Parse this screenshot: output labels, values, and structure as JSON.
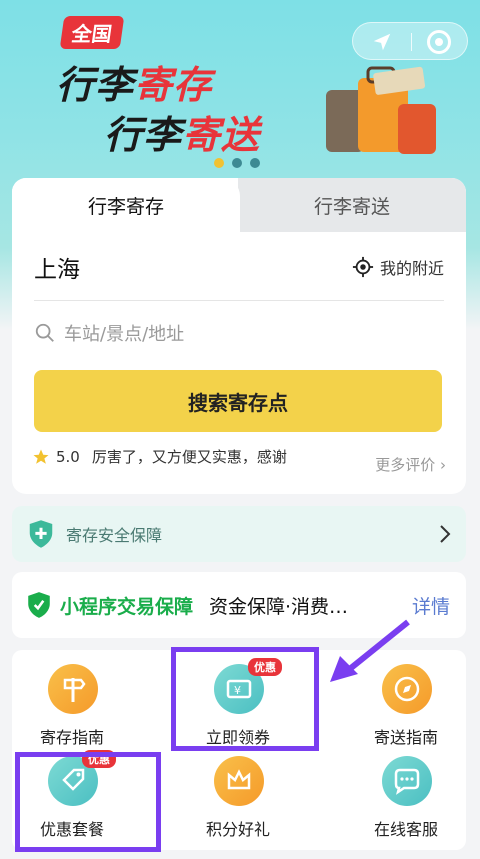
{
  "banner": {
    "chip": "全国",
    "line1_a": "行李",
    "line1_b": "寄存",
    "line2_a": "行李",
    "line2_b": "寄送"
  },
  "tabs": {
    "active": "行李寄存",
    "inactive": "行李寄送"
  },
  "location": {
    "city": "上海",
    "nearby_label": "我的附近"
  },
  "search": {
    "placeholder": "车站/景点/地址",
    "button_label": "搜索寄存点"
  },
  "review": {
    "rating": "5.0",
    "text": "厉害了，又方便又实惠，感谢",
    "more": "更多评价"
  },
  "safety": {
    "label": "寄存安全保障"
  },
  "mini_program": {
    "title": "小程序交易保障",
    "desc": "资金保障·消费…",
    "detail": "详情"
  },
  "services": [
    {
      "label": "寄存指南",
      "icon": "signpost-icon",
      "badge": ""
    },
    {
      "label": "立即领券",
      "icon": "coupon-icon",
      "badge": "优惠"
    },
    {
      "label": "寄送指南",
      "icon": "compass-icon",
      "badge": ""
    },
    {
      "label": "优惠套餐",
      "icon": "tag-icon",
      "badge": "优惠"
    },
    {
      "label": "积分好礼",
      "icon": "crown-icon",
      "badge": ""
    },
    {
      "label": "在线客服",
      "icon": "chat-icon",
      "badge": ""
    }
  ],
  "colors": {
    "accent_yellow": "#f3d24a",
    "badge_red": "#e8343a",
    "highlight_purple": "#7a3ef0",
    "mp_green": "#1aad4b"
  }
}
